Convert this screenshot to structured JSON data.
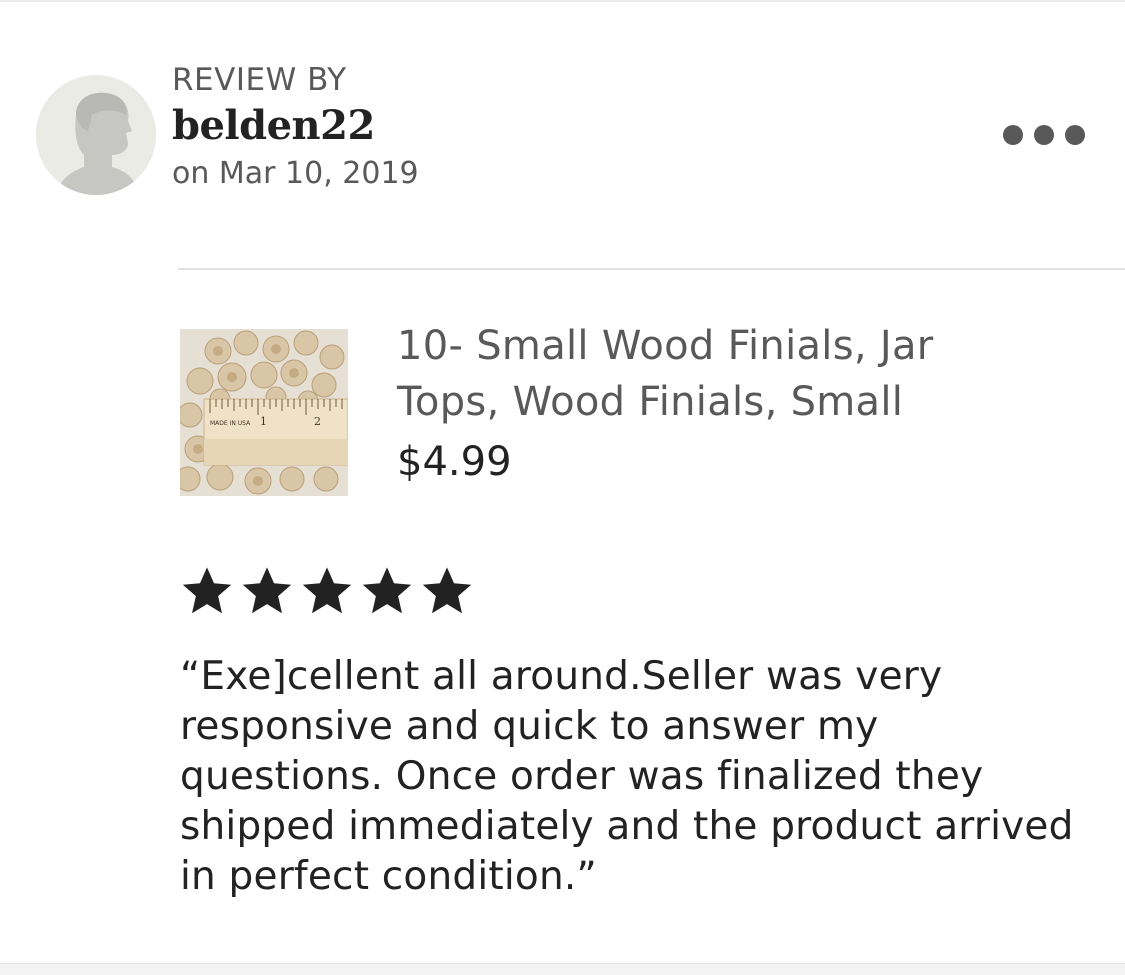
{
  "review": {
    "label": "REVIEW BY",
    "username": "belden22",
    "date": "on Mar 10, 2019",
    "rating": 5,
    "rating_max": 5,
    "text": "“Exe]cellent all around.Seller was very responsive and quick to answer my questions. Once order was finalized they shipped immediately and the product arrived in perfect condition.”"
  },
  "product": {
    "title": "10- Small Wood Finials, Jar Tops, Wood Finials, Small",
    "price": "$4.99",
    "image_label": "MADE IN USA",
    "ruler_marks": [
      "1",
      "2"
    ]
  },
  "icons": {
    "avatar": "default-user-silhouette-icon",
    "more": "more-horizontal-icon",
    "star": "star-filled-icon"
  },
  "colors": {
    "text_primary": "#222222",
    "text_secondary": "#595959",
    "avatar_bg": "#ebebe6",
    "avatar_figure": "#c6c6c2",
    "divider": "#e1e1e1"
  }
}
